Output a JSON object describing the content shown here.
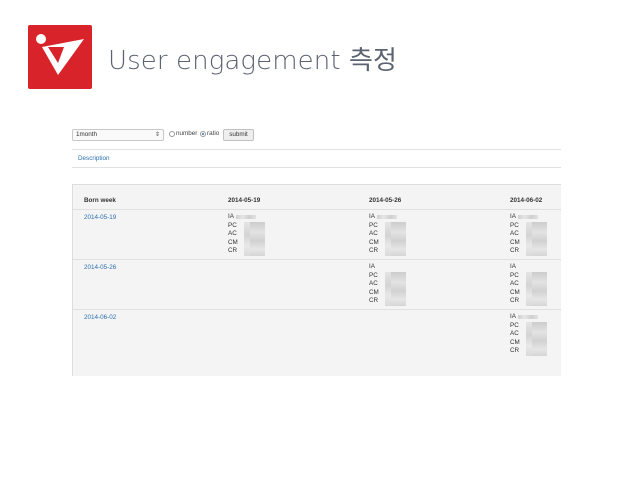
{
  "slide": {
    "title": "User engagement 측정"
  },
  "controls": {
    "period_value": "1month",
    "radio_number_label": "number",
    "radio_ratio_label": "ratio",
    "submit_label": "submit",
    "selected_mode": "ratio"
  },
  "tabs": {
    "description_label": "Description"
  },
  "table": {
    "headers": [
      "Born week",
      "2014-05-19",
      "2014-05-26",
      "2014-06-02"
    ],
    "rows": [
      {
        "born": "2014-05-19",
        "cells": [
          [
            "IA",
            "PC",
            "AC",
            "CM",
            "CR"
          ],
          [
            "IA",
            "PC",
            "AC",
            "CM",
            "CR"
          ],
          [
            "IA",
            "PC",
            "AC",
            "CM",
            "CR"
          ]
        ]
      },
      {
        "born": "2014-05-26",
        "cells": [
          [],
          [
            "IA",
            "PC",
            "AC",
            "CM",
            "CR"
          ],
          [
            "IA",
            "PC",
            "AC",
            "CM",
            "CR"
          ]
        ]
      },
      {
        "born": "2014-06-02",
        "cells": [
          [],
          [],
          [
            "IA",
            "PC",
            "AC",
            "CM",
            "CR"
          ]
        ]
      }
    ]
  },
  "colors": {
    "brand_red": "#d9232a",
    "link_blue": "#2a6fb0",
    "title_gray": "#5b6270"
  }
}
